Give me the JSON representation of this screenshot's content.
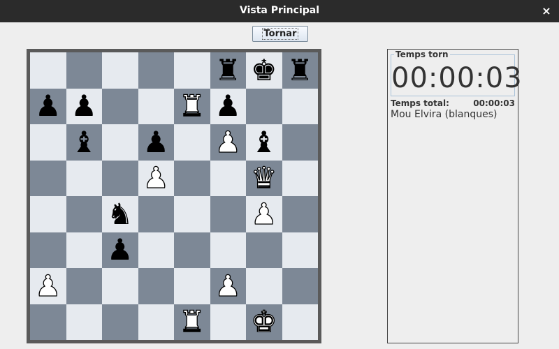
{
  "window": {
    "title": "Vista Principal",
    "close_glyph": "×"
  },
  "toolbar": {
    "tornar_label": "Tornar"
  },
  "board": {
    "rows": [
      [
        "",
        "",
        "",
        "",
        "",
        "br",
        "bk",
        "br"
      ],
      [
        "bp",
        "bp",
        "",
        "",
        "wr",
        "bp",
        "",
        ""
      ],
      [
        "",
        "bb",
        "",
        "bp",
        "",
        "wp",
        "bb",
        ""
      ],
      [
        "",
        "",
        "",
        "wp",
        "",
        "",
        "wq",
        ""
      ],
      [
        "",
        "",
        "bn",
        "",
        "",
        "",
        "wp",
        ""
      ],
      [
        "",
        "",
        "bp",
        "",
        "",
        "",
        "",
        ""
      ],
      [
        "wp",
        "",
        "",
        "",
        "",
        "wp",
        "",
        ""
      ],
      [
        "",
        "",
        "",
        "",
        "wr",
        "",
        "wk",
        ""
      ]
    ],
    "colors": {
      "light": "#e6eaef",
      "dark": "#7d8896",
      "frame": "#5a5a5a"
    }
  },
  "side_panel": {
    "turn_timer_label": "Temps torn",
    "turn_timer_value": "00:00:03",
    "total_time_label": "Temps total:",
    "total_time_value": "00:00:03",
    "player": "Mou Elvira (blanques)"
  }
}
